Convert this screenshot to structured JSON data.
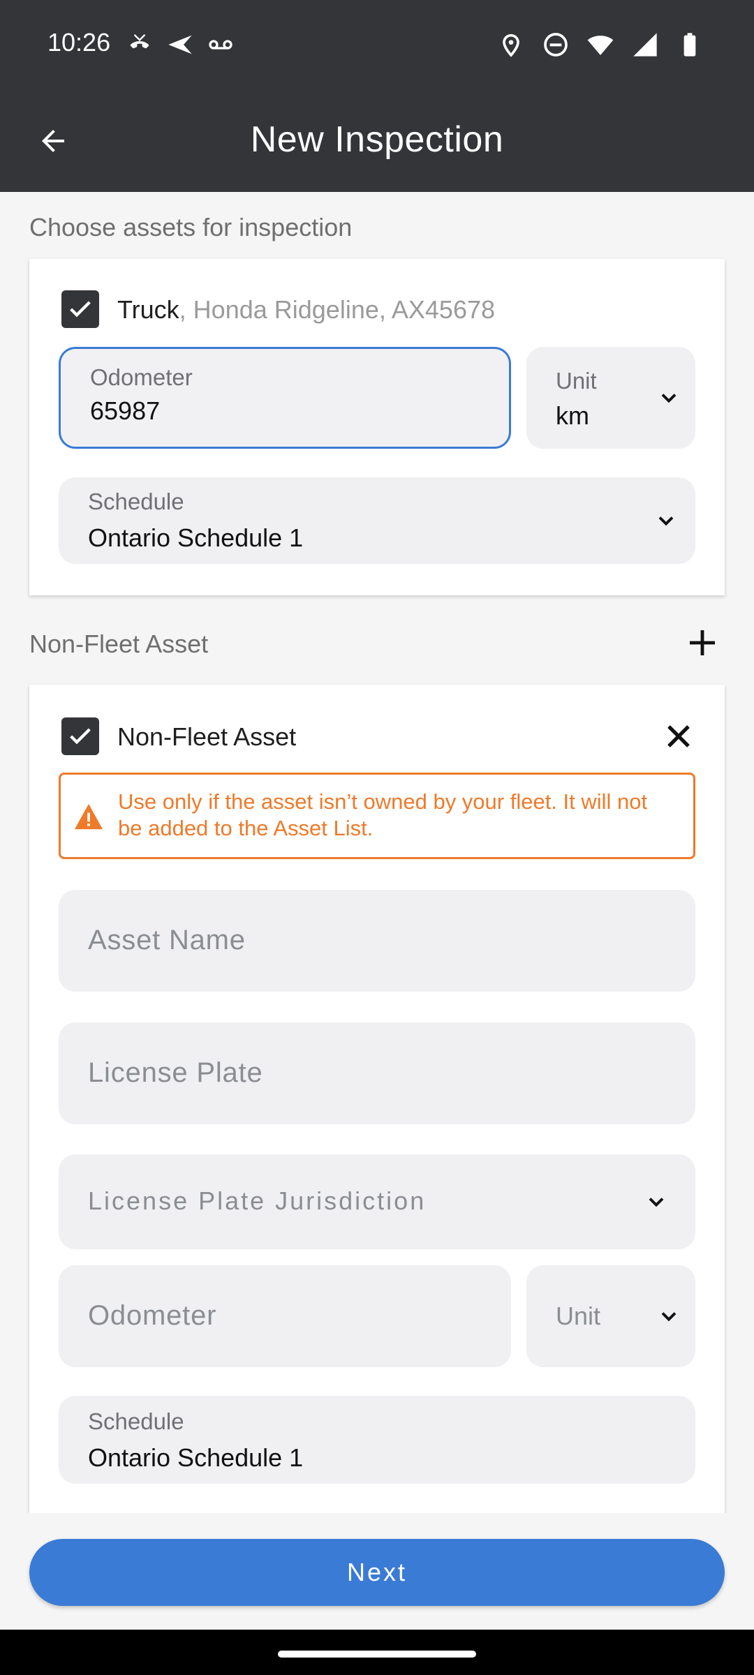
{
  "status_bar": {
    "time": "10:26",
    "left_icons": [
      "missed-call-icon",
      "send-icon",
      "voicemail-icon"
    ],
    "right_icons": [
      "location-icon",
      "do-not-disturb-icon",
      "wifi-icon",
      "signal-icon",
      "battery-icon"
    ]
  },
  "app_bar": {
    "title": "New Inspection"
  },
  "fleet_section": {
    "label": "Choose assets for inspection",
    "asset": {
      "checked": true,
      "name": "Truck",
      "details": ", Honda Ridgeline, AX45678",
      "odometer_label": "Odometer",
      "odometer_value": "65987",
      "unit_label": "Unit",
      "unit_value": "km",
      "schedule_label": "Schedule",
      "schedule_value": "Ontario Schedule 1"
    }
  },
  "non_fleet_section": {
    "label": "Non-Fleet Asset",
    "card": {
      "checked": true,
      "title": "Non-Fleet Asset",
      "warning": "Use only if the asset isn’t owned by your fleet. It will not be added to the Asset List.",
      "asset_name_placeholder": "Asset Name",
      "license_plate_placeholder": "License Plate",
      "jurisdiction_placeholder": "License Plate Jurisdiction",
      "odometer_placeholder": "Odometer",
      "unit_placeholder": "Unit",
      "schedule_label": "Schedule",
      "schedule_value": "Ontario Schedule 1"
    }
  },
  "footer": {
    "next_label": "Next"
  },
  "colors": {
    "primary": "#3a7bd5",
    "warning": "#ee7a2a",
    "header": "#343538"
  }
}
